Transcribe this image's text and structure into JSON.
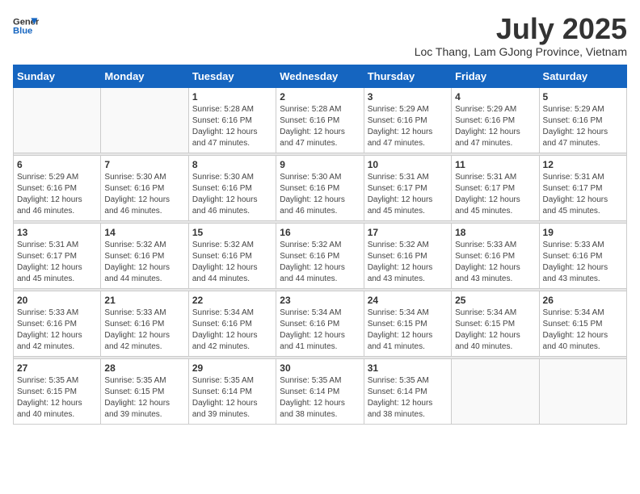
{
  "header": {
    "logo_line1": "General",
    "logo_line2": "Blue",
    "month_year": "July 2025",
    "location": "Loc Thang, Lam GJong Province, Vietnam"
  },
  "weekdays": [
    "Sunday",
    "Monday",
    "Tuesday",
    "Wednesday",
    "Thursday",
    "Friday",
    "Saturday"
  ],
  "weeks": [
    [
      {
        "day": "",
        "sunrise": "",
        "sunset": "",
        "daylight": ""
      },
      {
        "day": "",
        "sunrise": "",
        "sunset": "",
        "daylight": ""
      },
      {
        "day": "1",
        "sunrise": "Sunrise: 5:28 AM",
        "sunset": "Sunset: 6:16 PM",
        "daylight": "Daylight: 12 hours and 47 minutes."
      },
      {
        "day": "2",
        "sunrise": "Sunrise: 5:28 AM",
        "sunset": "Sunset: 6:16 PM",
        "daylight": "Daylight: 12 hours and 47 minutes."
      },
      {
        "day": "3",
        "sunrise": "Sunrise: 5:29 AM",
        "sunset": "Sunset: 6:16 PM",
        "daylight": "Daylight: 12 hours and 47 minutes."
      },
      {
        "day": "4",
        "sunrise": "Sunrise: 5:29 AM",
        "sunset": "Sunset: 6:16 PM",
        "daylight": "Daylight: 12 hours and 47 minutes."
      },
      {
        "day": "5",
        "sunrise": "Sunrise: 5:29 AM",
        "sunset": "Sunset: 6:16 PM",
        "daylight": "Daylight: 12 hours and 47 minutes."
      }
    ],
    [
      {
        "day": "6",
        "sunrise": "Sunrise: 5:29 AM",
        "sunset": "Sunset: 6:16 PM",
        "daylight": "Daylight: 12 hours and 46 minutes."
      },
      {
        "day": "7",
        "sunrise": "Sunrise: 5:30 AM",
        "sunset": "Sunset: 6:16 PM",
        "daylight": "Daylight: 12 hours and 46 minutes."
      },
      {
        "day": "8",
        "sunrise": "Sunrise: 5:30 AM",
        "sunset": "Sunset: 6:16 PM",
        "daylight": "Daylight: 12 hours and 46 minutes."
      },
      {
        "day": "9",
        "sunrise": "Sunrise: 5:30 AM",
        "sunset": "Sunset: 6:16 PM",
        "daylight": "Daylight: 12 hours and 46 minutes."
      },
      {
        "day": "10",
        "sunrise": "Sunrise: 5:31 AM",
        "sunset": "Sunset: 6:17 PM",
        "daylight": "Daylight: 12 hours and 45 minutes."
      },
      {
        "day": "11",
        "sunrise": "Sunrise: 5:31 AM",
        "sunset": "Sunset: 6:17 PM",
        "daylight": "Daylight: 12 hours and 45 minutes."
      },
      {
        "day": "12",
        "sunrise": "Sunrise: 5:31 AM",
        "sunset": "Sunset: 6:17 PM",
        "daylight": "Daylight: 12 hours and 45 minutes."
      }
    ],
    [
      {
        "day": "13",
        "sunrise": "Sunrise: 5:31 AM",
        "sunset": "Sunset: 6:17 PM",
        "daylight": "Daylight: 12 hours and 45 minutes."
      },
      {
        "day": "14",
        "sunrise": "Sunrise: 5:32 AM",
        "sunset": "Sunset: 6:16 PM",
        "daylight": "Daylight: 12 hours and 44 minutes."
      },
      {
        "day": "15",
        "sunrise": "Sunrise: 5:32 AM",
        "sunset": "Sunset: 6:16 PM",
        "daylight": "Daylight: 12 hours and 44 minutes."
      },
      {
        "day": "16",
        "sunrise": "Sunrise: 5:32 AM",
        "sunset": "Sunset: 6:16 PM",
        "daylight": "Daylight: 12 hours and 44 minutes."
      },
      {
        "day": "17",
        "sunrise": "Sunrise: 5:32 AM",
        "sunset": "Sunset: 6:16 PM",
        "daylight": "Daylight: 12 hours and 43 minutes."
      },
      {
        "day": "18",
        "sunrise": "Sunrise: 5:33 AM",
        "sunset": "Sunset: 6:16 PM",
        "daylight": "Daylight: 12 hours and 43 minutes."
      },
      {
        "day": "19",
        "sunrise": "Sunrise: 5:33 AM",
        "sunset": "Sunset: 6:16 PM",
        "daylight": "Daylight: 12 hours and 43 minutes."
      }
    ],
    [
      {
        "day": "20",
        "sunrise": "Sunrise: 5:33 AM",
        "sunset": "Sunset: 6:16 PM",
        "daylight": "Daylight: 12 hours and 42 minutes."
      },
      {
        "day": "21",
        "sunrise": "Sunrise: 5:33 AM",
        "sunset": "Sunset: 6:16 PM",
        "daylight": "Daylight: 12 hours and 42 minutes."
      },
      {
        "day": "22",
        "sunrise": "Sunrise: 5:34 AM",
        "sunset": "Sunset: 6:16 PM",
        "daylight": "Daylight: 12 hours and 42 minutes."
      },
      {
        "day": "23",
        "sunrise": "Sunrise: 5:34 AM",
        "sunset": "Sunset: 6:16 PM",
        "daylight": "Daylight: 12 hours and 41 minutes."
      },
      {
        "day": "24",
        "sunrise": "Sunrise: 5:34 AM",
        "sunset": "Sunset: 6:15 PM",
        "daylight": "Daylight: 12 hours and 41 minutes."
      },
      {
        "day": "25",
        "sunrise": "Sunrise: 5:34 AM",
        "sunset": "Sunset: 6:15 PM",
        "daylight": "Daylight: 12 hours and 40 minutes."
      },
      {
        "day": "26",
        "sunrise": "Sunrise: 5:34 AM",
        "sunset": "Sunset: 6:15 PM",
        "daylight": "Daylight: 12 hours and 40 minutes."
      }
    ],
    [
      {
        "day": "27",
        "sunrise": "Sunrise: 5:35 AM",
        "sunset": "Sunset: 6:15 PM",
        "daylight": "Daylight: 12 hours and 40 minutes."
      },
      {
        "day": "28",
        "sunrise": "Sunrise: 5:35 AM",
        "sunset": "Sunset: 6:15 PM",
        "daylight": "Daylight: 12 hours and 39 minutes."
      },
      {
        "day": "29",
        "sunrise": "Sunrise: 5:35 AM",
        "sunset": "Sunset: 6:14 PM",
        "daylight": "Daylight: 12 hours and 39 minutes."
      },
      {
        "day": "30",
        "sunrise": "Sunrise: 5:35 AM",
        "sunset": "Sunset: 6:14 PM",
        "daylight": "Daylight: 12 hours and 38 minutes."
      },
      {
        "day": "31",
        "sunrise": "Sunrise: 5:35 AM",
        "sunset": "Sunset: 6:14 PM",
        "daylight": "Daylight: 12 hours and 38 minutes."
      },
      {
        "day": "",
        "sunrise": "",
        "sunset": "",
        "daylight": ""
      },
      {
        "day": "",
        "sunrise": "",
        "sunset": "",
        "daylight": ""
      }
    ]
  ]
}
